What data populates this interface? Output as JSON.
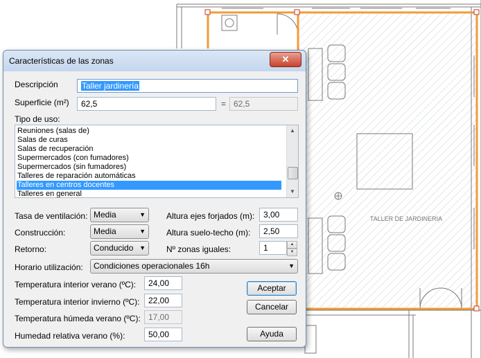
{
  "background": {
    "room_label": "TALLER DE JARDINERIA",
    "wall_color": "#f29b37"
  },
  "dialog": {
    "title": "Características de las zonas",
    "close_glyph": "✕",
    "descripcion": {
      "label": "Descripción",
      "value": "Taller jardinería"
    },
    "superficie": {
      "label": "Superficie (m²)",
      "value": "62,5",
      "equals": "=",
      "computed": "62,5"
    },
    "tipo_uso": {
      "label": "Tipo de uso:",
      "items": [
        "Reuniones (salas de)",
        "Salas de curas",
        "Salas de recuperación",
        "Supermercados (con fumadores)",
        "Supermercados (sin fumadores)",
        "Talleres de reparación automáticas",
        "Talleres en centros docentes",
        "Talleres en general"
      ],
      "selected": "Talleres en centros docentes"
    },
    "tasa_ventilacion": {
      "label": "Tasa de ventilación:",
      "value": "Media"
    },
    "construccion": {
      "label": "Construcción:",
      "value": "Media"
    },
    "retorno": {
      "label": "Retorno:",
      "value": "Conducido"
    },
    "altura_ejes": {
      "label": "Altura ejes forjados (m):",
      "value": "3,00"
    },
    "altura_suelo": {
      "label": "Altura suelo-techo (m):",
      "value": "2,50"
    },
    "zonas_iguales": {
      "label": "Nº zonas iguales:",
      "value": "1"
    },
    "horario": {
      "label": "Horario utilización:",
      "value": "Condiciones operacionales 16h"
    },
    "temp_verano": {
      "label": "Temperatura interior verano (ºC):",
      "value": "24,00"
    },
    "temp_invierno": {
      "label": "Temperatura interior invierno (ºC):",
      "value": "22,00"
    },
    "temp_humeda": {
      "label": "Temperatura húmeda verano (ºC):",
      "value": "17,00"
    },
    "humedad": {
      "label": "Humedad relativa verano (%):",
      "value": "50,00"
    },
    "buttons": {
      "aceptar": "Aceptar",
      "cancelar": "Cancelar",
      "ayuda": "Ayuda"
    }
  }
}
